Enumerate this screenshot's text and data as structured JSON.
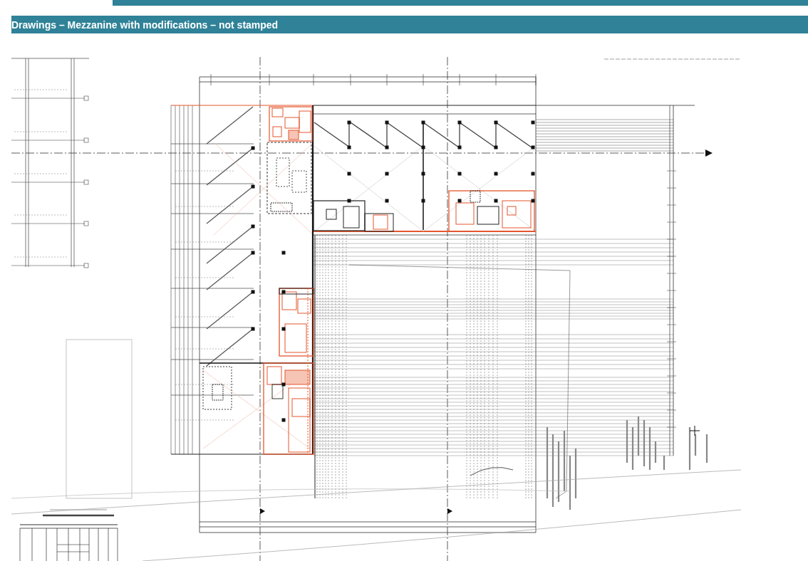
{
  "section_header": {
    "title": "Drawings – Mezzanine with modifications – not stamped"
  }
}
